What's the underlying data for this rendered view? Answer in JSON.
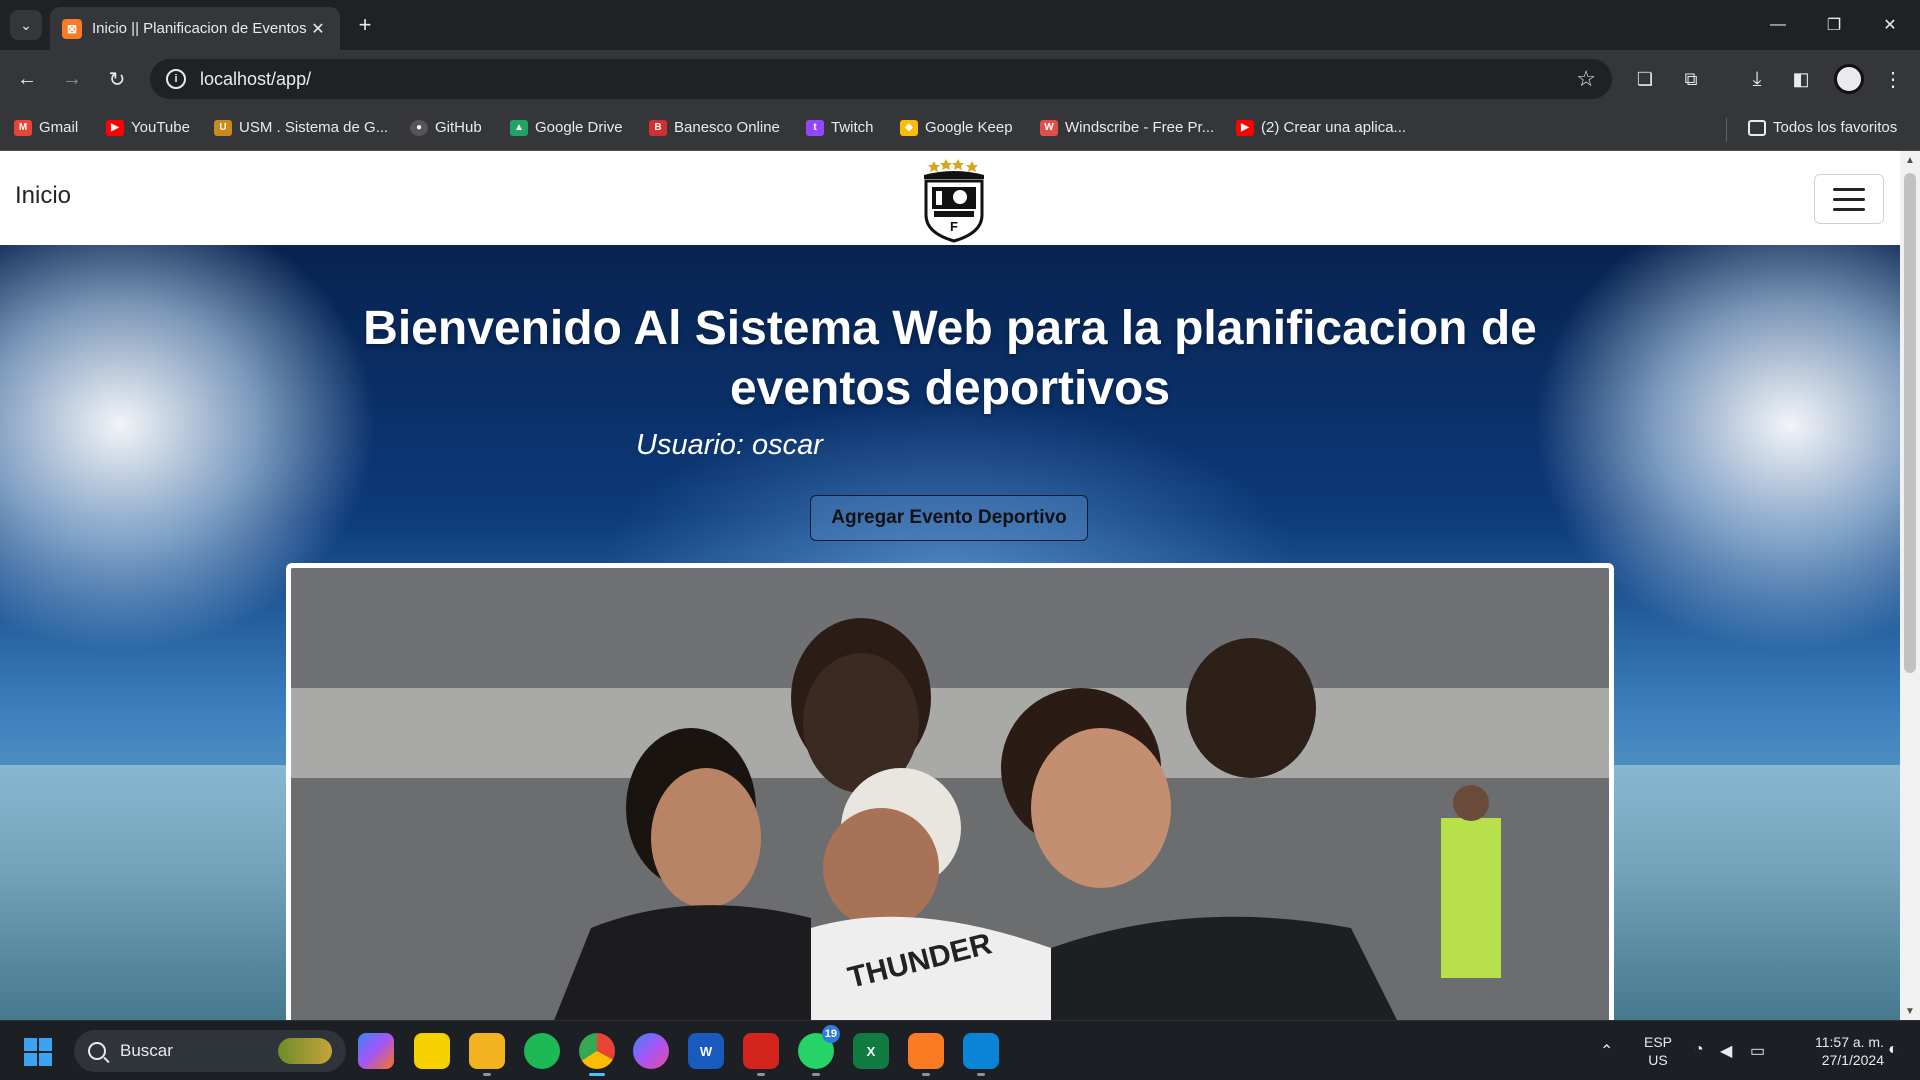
{
  "browser": {
    "tab": {
      "title": "Inicio || Planificacion de Eventos Deportivos",
      "favicon": "xampp-icon"
    },
    "url": "localhost/app/",
    "bookmarks": [
      {
        "label": "Gmail",
        "icon": "gmail-icon",
        "color": "#ea4335"
      },
      {
        "label": "YouTube",
        "icon": "youtube-icon",
        "color": "#ff0000"
      },
      {
        "label": "USM . Sistema de G...",
        "icon": "usm-icon",
        "color": "#c98a1b"
      },
      {
        "label": "GitHub",
        "icon": "github-icon",
        "color": "#555555"
      },
      {
        "label": "Google Drive",
        "icon": "google-drive-icon",
        "color": "#1fa463"
      },
      {
        "label": "Banesco Online",
        "icon": "banesco-icon",
        "color": "#d32f2f"
      },
      {
        "label": "Twitch",
        "icon": "twitch-icon",
        "color": "#9146ff"
      },
      {
        "label": "Google Keep",
        "icon": "google-keep-icon",
        "color": "#fbbc04"
      },
      {
        "label": "Windscribe - Free Pr...",
        "icon": "windscribe-icon",
        "color": "#e0504a"
      },
      {
        "label": "(2) Crear una aplica...",
        "icon": "youtube-icon",
        "color": "#ff0000"
      }
    ],
    "all_bookmarks": "Todos los favoritos"
  },
  "page": {
    "nav_brand": "Inicio",
    "hero_title": "Bienvenido Al Sistema Web para la planificacion de eventos deportivos",
    "user_label": "Usuario: oscar",
    "add_button": "Agregar Evento Deportivo"
  },
  "taskbar": {
    "search_placeholder": "Buscar",
    "apps": [
      {
        "name": "copilot-icon",
        "color": "#7b5cff",
        "label": ""
      },
      {
        "name": "sticky-notes-icon",
        "color": "#f7d000",
        "label": ""
      },
      {
        "name": "file-explorer-icon",
        "color": "#f3b321",
        "label": ""
      },
      {
        "name": "spotify-icon",
        "color": "#1db954",
        "label": ""
      },
      {
        "name": "chrome-icon",
        "color": "#4285f4",
        "label": "",
        "active": true
      },
      {
        "name": "messenger-icon",
        "color": "#8b5cf6",
        "label": ""
      },
      {
        "name": "word-icon",
        "color": "#185abd",
        "label": "W"
      },
      {
        "name": "acrobat-icon",
        "color": "#d4241c",
        "label": ""
      },
      {
        "name": "whatsapp-icon",
        "color": "#25d366",
        "label": "",
        "badge": "19"
      },
      {
        "name": "excel-icon",
        "color": "#107c41",
        "label": "X"
      },
      {
        "name": "xampp-icon",
        "color": "#fb7a24",
        "label": ""
      },
      {
        "name": "vscode-icon",
        "color": "#0a84d6",
        "label": ""
      }
    ],
    "language": "ESP",
    "region": "US",
    "time": "11:57 a. m.",
    "date": "27/1/2024"
  }
}
